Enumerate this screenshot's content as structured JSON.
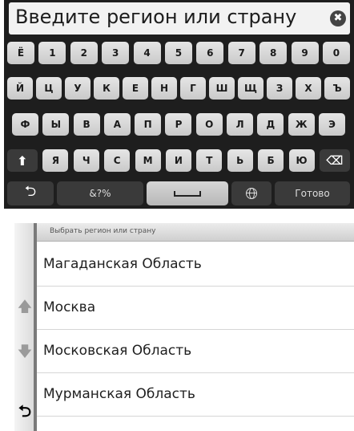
{
  "keyboard": {
    "input_value": "Введите регион или страну",
    "clear_symbol": "✖",
    "rows": [
      [
        "Ё",
        "1",
        "2",
        "3",
        "4",
        "5",
        "6",
        "7",
        "8",
        "9",
        "0"
      ],
      [
        "Й",
        "Ц",
        "У",
        "К",
        "Е",
        "Н",
        "Г",
        "Ш",
        "Щ",
        "З",
        "Х",
        "Ъ"
      ],
      [
        "Ф",
        "Ы",
        "В",
        "А",
        "П",
        "Р",
        "О",
        "Л",
        "Д",
        "Ж",
        "Э"
      ],
      [
        "Я",
        "Ч",
        "С",
        "М",
        "И",
        "Т",
        "Ь",
        "Б",
        "Ю"
      ]
    ],
    "shift_symbol": "⬆",
    "backspace_symbol": "⌫",
    "back_symbol": "⮌",
    "symbols_label": "&?%",
    "done_label": "Готово"
  },
  "list": {
    "header": "Выбрать регион или страну",
    "items": [
      "Магаданская Область",
      "Москва",
      "Московская Область",
      "Мурманская Область"
    ],
    "up_symbol": "🡅",
    "down_symbol": "🡇",
    "back_symbol": "⮌"
  }
}
